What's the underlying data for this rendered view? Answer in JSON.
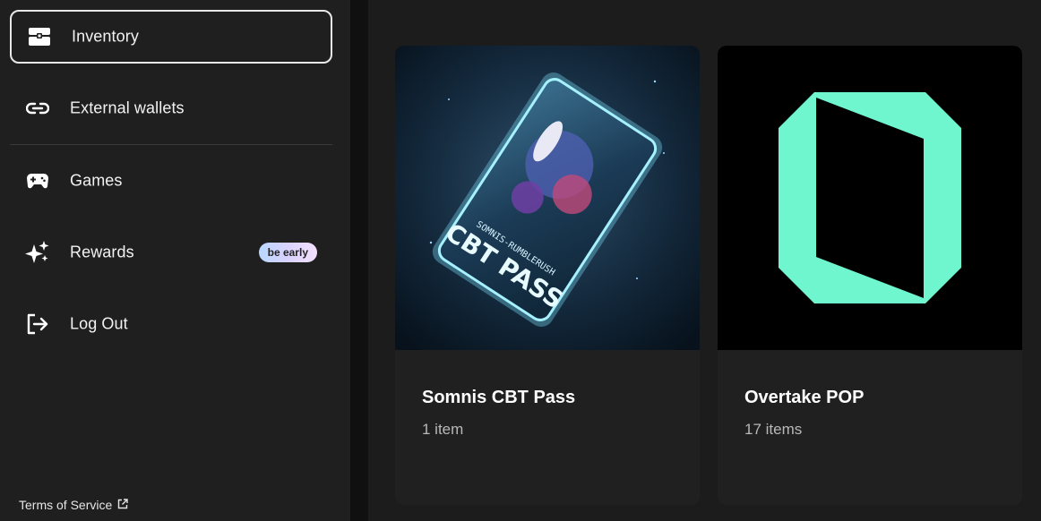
{
  "sidebar": {
    "items": [
      {
        "label": "Inventory",
        "icon": "inventory-chest-icon",
        "active": true
      },
      {
        "label": "External wallets",
        "icon": "link-icon"
      },
      {
        "label": "Games",
        "icon": "gamepad-icon"
      },
      {
        "label": "Rewards",
        "icon": "sparkles-icon",
        "badge": "be early"
      },
      {
        "label": "Log Out",
        "icon": "logout-icon"
      }
    ],
    "footer_link": "Terms of Service",
    "footer_icon": "external-link-icon"
  },
  "collections": [
    {
      "title": "Somnis CBT Pass",
      "count": "1 item",
      "image_text_top": "SOMNIS-RUMBLERUSH",
      "image_text_main": "CBT PASS"
    },
    {
      "title": "Overtake POP",
      "count": "17 items"
    }
  ],
  "colors": {
    "accent_mint": "#6ff6cf",
    "sidebar_bg": "#1f1f1f",
    "main_bg": "#1c1c1c",
    "card_bg": "#202020"
  }
}
